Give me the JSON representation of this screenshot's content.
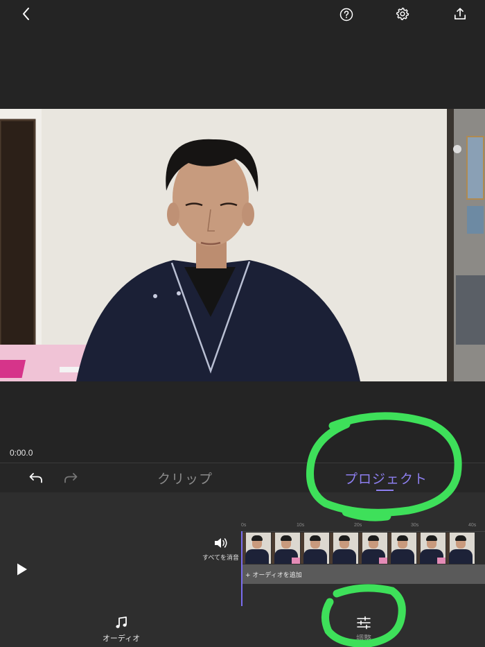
{
  "toolbar": {
    "icons": [
      "chevron-left-icon",
      "help-icon",
      "gear-icon",
      "share-icon"
    ]
  },
  "preview": {
    "timecode": "0:00.0"
  },
  "tabs": {
    "clip": "クリップ",
    "project": "プロジェクト",
    "active": "project"
  },
  "timeline": {
    "mute_all_label": "すべてを消音",
    "add_audio_label": "+ オーディオを追加",
    "ticks": [
      "0s",
      "10s",
      "20s",
      "30s",
      "40s"
    ],
    "frame_count": 8
  },
  "bottom": {
    "audio_label": "オーディオ",
    "adjust_label": "調整"
  },
  "colors": {
    "accent": "#8d7ff0",
    "annotation": "#3ee05a",
    "background": "#242424"
  }
}
